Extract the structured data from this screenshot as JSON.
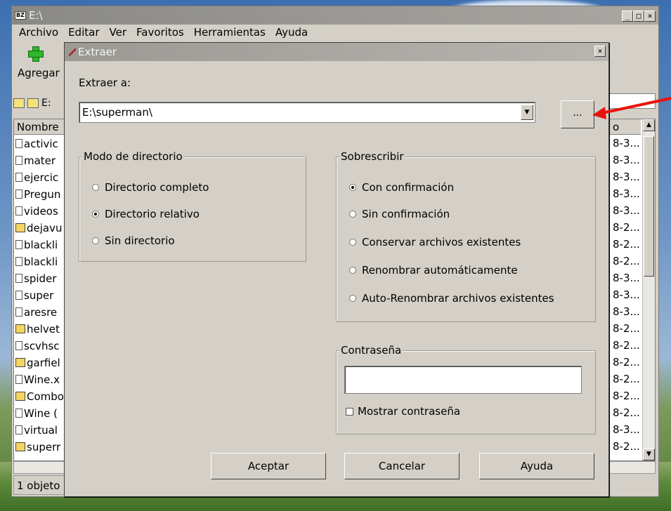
{
  "main_window": {
    "title": "E:\\",
    "menu": [
      "Archivo",
      "Editar",
      "Ver",
      "Favoritos",
      "Herramientas",
      "Ayuda"
    ],
    "toolbar_add": "Agregar",
    "address_partial": "E:",
    "column_name": "Nombre",
    "column_right": "o",
    "status": "1 objeto",
    "files_left": [
      "activic",
      "mater",
      "ejercic",
      "Pregun",
      "videos",
      "dejavu",
      "blackli",
      "blackli",
      "spider",
      "super",
      "aresre",
      "helvet",
      "scvhsc",
      "garfiel",
      "Wine.x",
      "Combo",
      "Wine (",
      "virtual",
      "superr"
    ],
    "files_right": [
      "8-3...",
      "8-3...",
      "8-3...",
      "8-3...",
      "8-3...",
      "8-2...",
      "8-2...",
      "8-2...",
      "8-3...",
      "8-3...",
      "8-3...",
      "8-2...",
      "8-2...",
      "8-2...",
      "8-2...",
      "8-2...",
      "8-2...",
      "8-3...",
      "8-2..."
    ]
  },
  "dialog": {
    "title": "Extraer",
    "extract_to_label": "Extraer a:",
    "path_value": "E:\\superman\\",
    "browse_label": "...",
    "dir_mode": {
      "title": "Modo de directorio",
      "options": [
        "Directorio completo",
        "Directorio relativo",
        "Sin directorio"
      ],
      "selected": "Directorio relativo"
    },
    "overwrite": {
      "title": "Sobrescribir",
      "options": [
        "Con confirmación",
        "Sin confirmación",
        "Conservar archivos existentes",
        "Renombrar automáticamente",
        "Auto-Renombrar archivos existentes"
      ],
      "selected": "Con confirmación"
    },
    "password": {
      "title": "Contraseña",
      "value": "",
      "show_label": "Mostrar contraseña",
      "show_checked": false
    },
    "buttons": {
      "accept": "Aceptar",
      "cancel": "Cancelar",
      "help": "Ayuda"
    }
  },
  "colors": {
    "annotation_arrow": "#e8140c",
    "title_bar": "#9b9994",
    "window_bg": "#d4d0c8"
  }
}
